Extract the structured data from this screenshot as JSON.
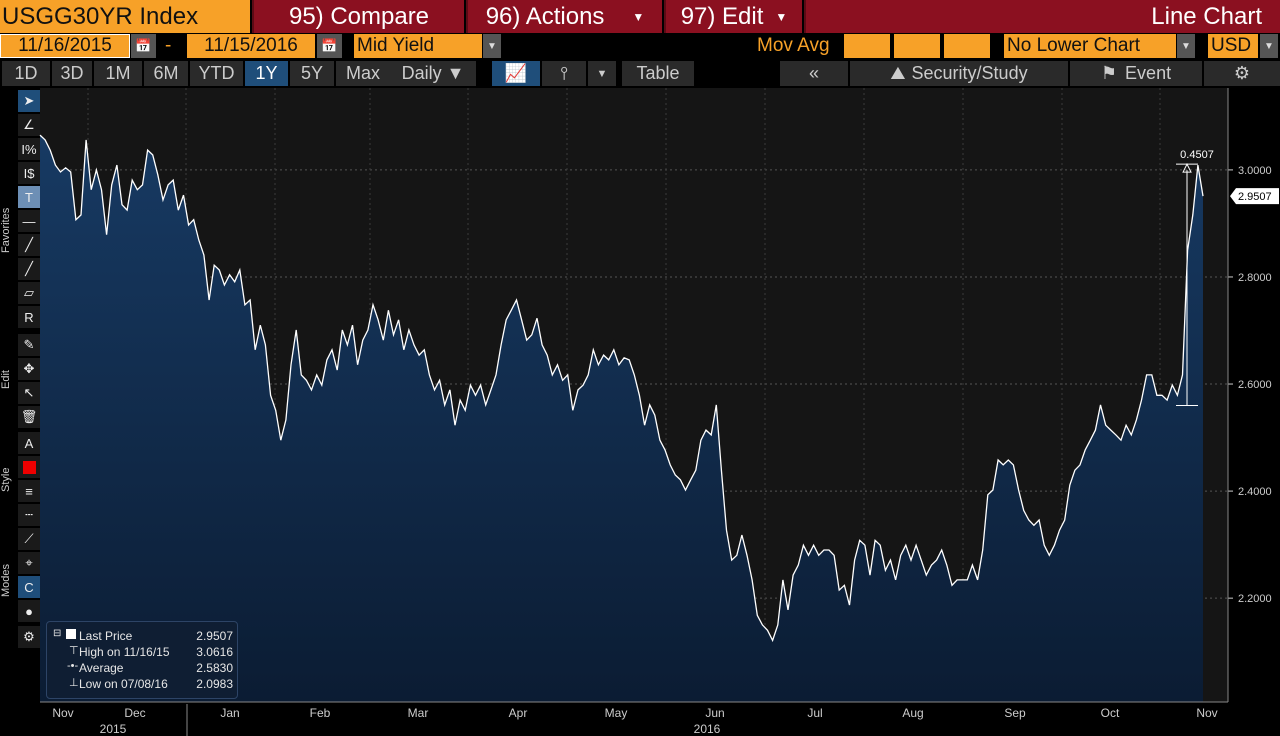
{
  "header": {
    "ticker": "USGG30YR Index",
    "compare": "95) Compare",
    "actions": "96) Actions",
    "edit": "97) Edit",
    "chart_type": "Line Chart"
  },
  "controls": {
    "start_date": "11/16/2015",
    "dash": "-",
    "end_date": "11/15/2016",
    "field": "Mid Yield",
    "mov_avg": "Mov Avg",
    "lower_chart": "No Lower Chart",
    "currency": "USD"
  },
  "periods": [
    "1D",
    "3D",
    "1M",
    "6M",
    "YTD",
    "1Y",
    "5Y",
    "Max"
  ],
  "selected_period": "1Y",
  "frequency": "Daily ▼",
  "table": "Table",
  "security_study": "Security/Study",
  "event": "Event",
  "sidebar": {
    "favorites": "Favorites",
    "edit": "Edit",
    "style": "Style",
    "modes": "Modes"
  },
  "legend": {
    "last_label": "Last Price",
    "last": "2.9507",
    "high_label": "High on 11/16/15",
    "high": "3.0616",
    "avg_label": "Average",
    "avg": "2.5830",
    "low_label": "Low on 07/08/16",
    "low": "2.0983"
  },
  "colors": {
    "accent": "#f7a128",
    "header_red": "#8b1020",
    "area": "#0f2a4a",
    "line": "#ffffff"
  },
  "chart_data": {
    "type": "area",
    "title": "USGG30YR Index",
    "ylabel": "Mid Yield",
    "ylim": [
      2.006,
      3.153
    ],
    "grid": true,
    "yticks": [
      "2.2000",
      "2.4000",
      "2.6000",
      "2.8000",
      "3.0000"
    ],
    "ytick_values": [
      2.2,
      2.4,
      2.6,
      2.8,
      3.0
    ],
    "months": [
      "Nov",
      "Dec",
      "Jan",
      "Feb",
      "Mar",
      "Apr",
      "May",
      "Jun",
      "Jul",
      "Aug",
      "Sep",
      "Oct",
      "Nov"
    ],
    "years": [
      "2015",
      "2016"
    ],
    "annotation": {
      "change": "0.4507",
      "last_tag": "2.9507",
      "from": 2.56,
      "to": 3.0107
    },
    "values": [
      3.065,
      3.056,
      3.037,
      3.009,
      2.996,
      3.004,
      2.996,
      2.907,
      2.916,
      3.056,
      2.963,
      3.0,
      2.963,
      2.879,
      2.972,
      3.009,
      2.935,
      2.925,
      2.981,
      2.963,
      2.972,
      3.037,
      3.028,
      2.991,
      2.944,
      2.972,
      2.981,
      2.925,
      2.953,
      2.897,
      2.907,
      2.869,
      2.841,
      2.757,
      2.822,
      2.813,
      2.785,
      2.804,
      2.791,
      2.813,
      2.748,
      2.757,
      2.664,
      2.71,
      2.673,
      2.579,
      2.551,
      2.495,
      2.533,
      2.636,
      2.701,
      2.617,
      2.607,
      2.589,
      2.617,
      2.598,
      2.645,
      2.664,
      2.626,
      2.701,
      2.673,
      2.71,
      2.636,
      2.682,
      2.701,
      2.748,
      2.72,
      2.682,
      2.738,
      2.692,
      2.72,
      2.664,
      2.701,
      2.673,
      2.654,
      2.664,
      2.617,
      2.589,
      2.607,
      2.561,
      2.589,
      2.523,
      2.57,
      2.551,
      2.598,
      2.579,
      2.598,
      2.561,
      2.589,
      2.617,
      2.673,
      2.72,
      2.738,
      2.757,
      2.72,
      2.682,
      2.692,
      2.723,
      2.673,
      2.654,
      2.617,
      2.636,
      2.607,
      2.617,
      2.551,
      2.589,
      2.598,
      2.617,
      2.664,
      2.636,
      2.654,
      2.645,
      2.664,
      2.636,
      2.649,
      2.645,
      2.617,
      2.579,
      2.523,
      2.561,
      2.542,
      2.495,
      2.477,
      2.449,
      2.43,
      2.421,
      2.402,
      2.421,
      2.439,
      2.495,
      2.514,
      2.505,
      2.561,
      2.439,
      2.327,
      2.271,
      2.28,
      2.318,
      2.28,
      2.234,
      2.168,
      2.15,
      2.14,
      2.121,
      2.15,
      2.234,
      2.178,
      2.243,
      2.262,
      2.299,
      2.28,
      2.299,
      2.28,
      2.29,
      2.29,
      2.28,
      2.215,
      2.224,
      2.187,
      2.271,
      2.308,
      2.299,
      2.243,
      2.308,
      2.299,
      2.252,
      2.271,
      2.234,
      2.28,
      2.299,
      2.271,
      2.299,
      2.271,
      2.243,
      2.262,
      2.271,
      2.29,
      2.262,
      2.224,
      2.234,
      2.234,
      2.234,
      2.262,
      2.234,
      2.29,
      2.393,
      2.402,
      2.458,
      2.449,
      2.458,
      2.449,
      2.402,
      2.364,
      2.346,
      2.336,
      2.346,
      2.299,
      2.28,
      2.299,
      2.327,
      2.346,
      2.411,
      2.439,
      2.449,
      2.477,
      2.495,
      2.514,
      2.561,
      2.523,
      2.514,
      2.505,
      2.495,
      2.523,
      2.505,
      2.533,
      2.57,
      2.617,
      2.617,
      2.579,
      2.579,
      2.57,
      2.598,
      2.579,
      2.617,
      2.85,
      2.916,
      3.009,
      2.951
    ]
  }
}
